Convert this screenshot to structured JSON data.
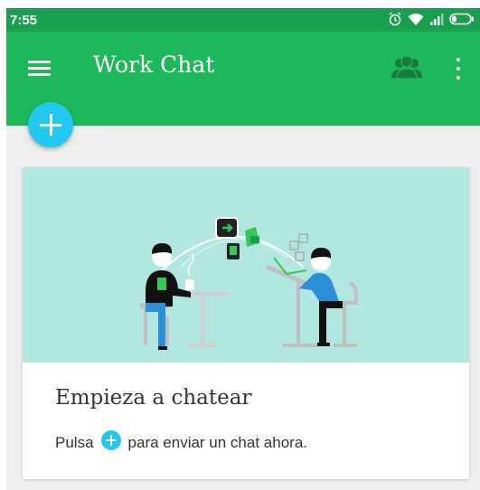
{
  "status_bar": {
    "time": "7:55",
    "icons": [
      "alarm-icon",
      "wifi-icon",
      "signal-icon",
      "battery-icon"
    ]
  },
  "app_bar": {
    "title": "Work Chat",
    "icons": [
      "menu-icon",
      "contacts-icon",
      "more-vert-icon"
    ]
  },
  "fab": {
    "icon": "plus-icon"
  },
  "card": {
    "title": "Empieza a chatear",
    "desc_before": "Pulsa",
    "desc_icon": "plus-icon",
    "desc_after": "para enviar un chat ahora."
  },
  "colors": {
    "status_bar": "#1a9e50",
    "app_bar": "#1eb85b",
    "accent": "#22c8f0",
    "illustration_bg": "#b2e6e0",
    "background": "#eeeeee"
  }
}
